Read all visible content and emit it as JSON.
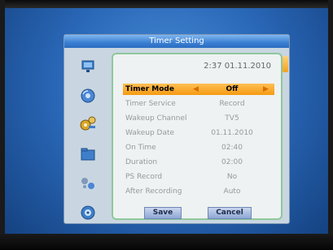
{
  "window": {
    "title": "Timer Setting"
  },
  "datetime": "2:37 01.11.2010",
  "rows": [
    {
      "label": "Timer Mode",
      "value": "Off",
      "active": true
    },
    {
      "label": "Timer Service",
      "value": "Record",
      "active": false
    },
    {
      "label": "Wakeup Channel",
      "value": "TV5",
      "active": false
    },
    {
      "label": "Wakeup Date",
      "value": "01.11.2010",
      "active": false
    },
    {
      "label": "On Time",
      "value": "02:40",
      "active": false
    },
    {
      "label": "Duration",
      "value": "02:00",
      "active": false
    },
    {
      "label": "PS Record",
      "value": "No",
      "active": false
    },
    {
      "label": "After Recording",
      "value": "Auto",
      "active": false
    }
  ],
  "buttons": {
    "save": "Save",
    "cancel": "Cancel"
  },
  "sidebar_icons": [
    "monitor-icon",
    "disc-icon",
    "tools-icon",
    "folder-icon",
    "media-icon",
    "info-icon"
  ],
  "colors": {
    "titlebar": "#3a7fd2",
    "highlight": "#f59a12",
    "panel_border": "#8fc79b"
  }
}
